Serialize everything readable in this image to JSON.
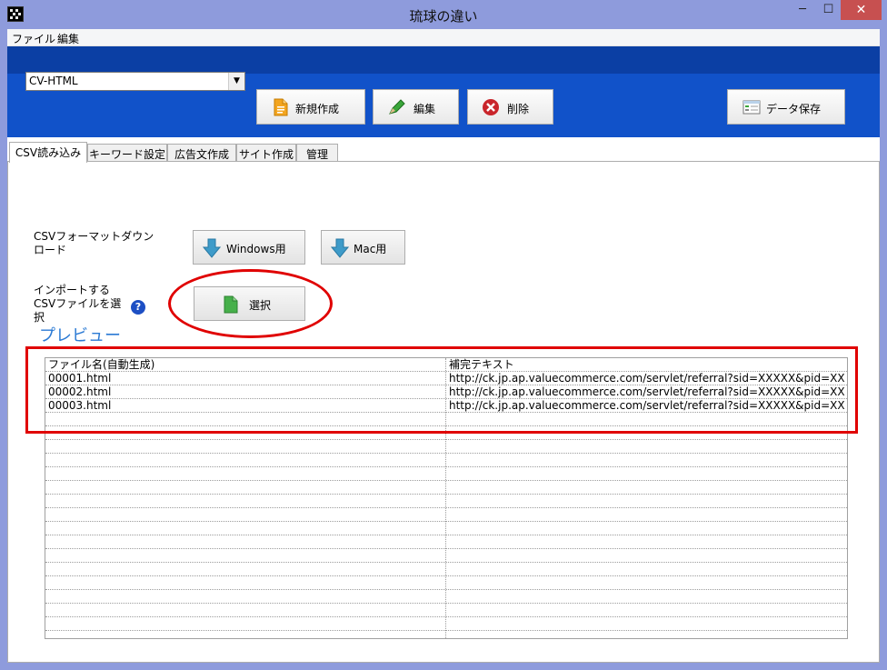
{
  "window": {
    "title": "琉球の違い",
    "minimize": "─",
    "maximize": "☐",
    "close": "✕"
  },
  "menu": {
    "file": "ファイル",
    "edit": "編集"
  },
  "toolbar": {
    "combo_value": "CV-HTML",
    "new_label": "新規作成",
    "edit_label": "編集",
    "delete_label": "削除",
    "save_label": "データ保存"
  },
  "tabs": [
    {
      "label": "CSV読み込み",
      "active": true
    },
    {
      "label": "キーワード設定"
    },
    {
      "label": "広告文作成"
    },
    {
      "label": "サイト作成"
    },
    {
      "label": "管理"
    }
  ],
  "panel": {
    "csv_format_label": "CSVフォーマットダウンロード",
    "windows_button": "Windows用",
    "mac_button": "Mac用",
    "import_label": "インポートするCSVファイルを選択",
    "help": "?",
    "select_button": "選択",
    "preview_title": "プレビュー"
  },
  "grid": {
    "headers": [
      "ファイル名(自動生成)",
      "補完テキスト"
    ],
    "rows": [
      [
        "00001.html",
        "http://ck.jp.ap.valuecommerce.com/servlet/referral?sid=XXXXX&pid=XXXXXX"
      ],
      [
        "00002.html",
        "http://ck.jp.ap.valuecommerce.com/servlet/referral?sid=XXXXX&pid=XXXXXX"
      ],
      [
        "00003.html",
        "http://ck.jp.ap.valuecommerce.com/servlet/referral?sid=XXXXX&pid=XXXXXX"
      ]
    ]
  },
  "colors": {
    "toolbar_blue": "#1152c9",
    "frame": "#8e9bdc",
    "highlight_red": "#e00000",
    "preview_blue": "#2b7ad4"
  }
}
